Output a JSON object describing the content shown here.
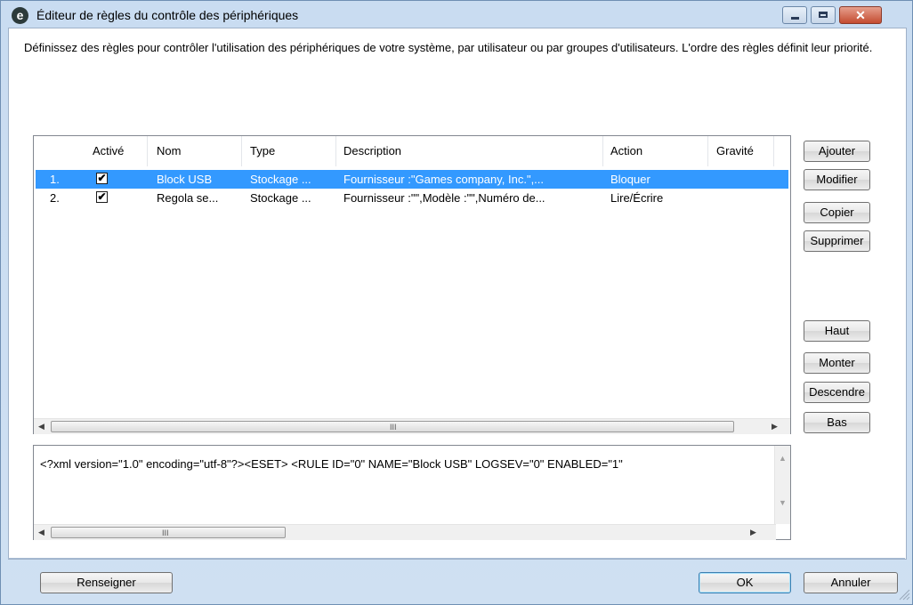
{
  "window": {
    "title": "Éditeur de règles du contrôle des périphériques",
    "logo_letter": "e",
    "close_glyph": "✕"
  },
  "description": "Définissez des règles pour contrôler l'utilisation des périphériques de votre système, par utilisateur ou par groupes d'utilisateurs. L'ordre des règles définit leur priorité.",
  "table": {
    "columns": [
      "",
      "Activé",
      "Nom",
      "Type",
      "Description",
      "Action",
      "Gravité"
    ],
    "rows": [
      {
        "index": "1.",
        "enabled": true,
        "name": "Block USB",
        "type": "Stockage ...",
        "description": "Fournisseur :\"Games company, Inc.\",...",
        "action": "Bloquer",
        "severity": ""
      },
      {
        "index": "2.",
        "enabled": true,
        "name": "Regola se...",
        "type": "Stockage ...",
        "description": "Fournisseur :\"\",Modèle :\"\",Numéro de...",
        "action": "Lire/Écrire",
        "severity": ""
      }
    ],
    "selected_row": 0
  },
  "xml_preview": "<?xml version=\"1.0\" encoding=\"utf-8\"?><ESET> <RULE ID=\"0\" NAME=\"Block USB\" LOGSEV=\"0\" ENABLED=\"1\"",
  "side_buttons": {
    "add": "Ajouter",
    "edit": "Modifier",
    "copy": "Copier",
    "delete": "Supprimer",
    "top": "Haut",
    "up": "Monter",
    "down": "Descendre",
    "bottom": "Bas"
  },
  "footer": {
    "populate": "Renseigner",
    "ok": "OK",
    "cancel": "Annuler"
  },
  "scroll_glyphs": {
    "left": "◀",
    "right": "▶",
    "up": "▲",
    "down": "▼",
    "grip": "III"
  },
  "colors": {
    "selection": "#3399ff",
    "title_bar": "#c9dcf1",
    "close_button": "#c44b30"
  }
}
